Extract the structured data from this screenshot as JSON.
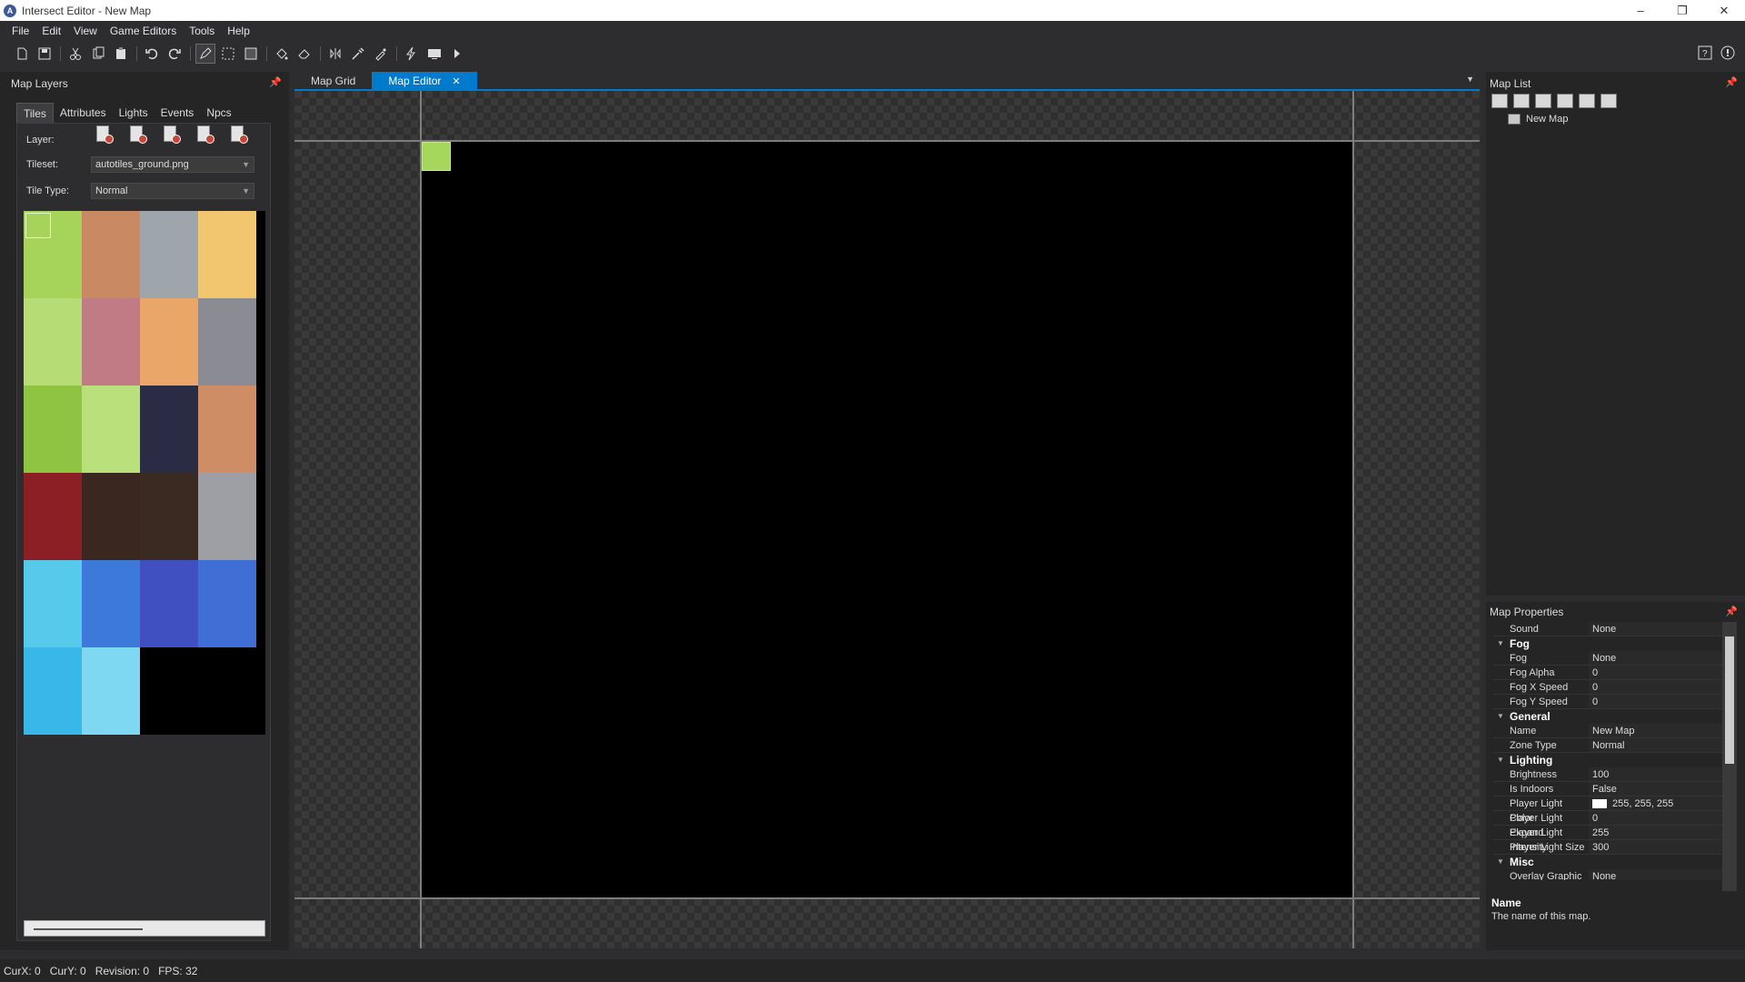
{
  "window": {
    "title": "Intersect Editor - New Map",
    "logo": "A",
    "minimize": "–",
    "restore": "❐",
    "close": "✕"
  },
  "menu": [
    "File",
    "Edit",
    "View",
    "Game Editors",
    "Tools",
    "Help"
  ],
  "toolbar_icons": [
    "new-map-icon",
    "save-icon",
    "cut-icon",
    "copy-icon",
    "paste-icon",
    "undo-icon",
    "redo-icon",
    "pen-tool-icon",
    "selection-tool-icon",
    "rectangle-tool-icon",
    "fill-tool-icon",
    "erase-tool-icon",
    "eyedropper-icon",
    "flip-icon",
    "dropper-icon",
    "lightning-icon",
    "screenshot-icon",
    "play-icon"
  ],
  "map_layers": {
    "title": "Map Layers",
    "tabs": [
      "Tiles",
      "Attributes",
      "Lights",
      "Events",
      "Npcs"
    ],
    "active_tab": "Tiles",
    "layer_label": "Layer:",
    "tileset_label": "Tileset:",
    "tileset_value": "autotiles_ground.png",
    "tiletype_label": "Tile Type:",
    "tiletype_value": "Normal"
  },
  "doc_tabs": {
    "map_grid": "Map Grid",
    "map_editor": "Map Editor",
    "close": "✕",
    "overflow": "▼"
  },
  "map_list": {
    "title": "Map List",
    "items": [
      "New Map"
    ]
  },
  "map_properties": {
    "title": "Map Properties",
    "rows": [
      {
        "k": "Sound",
        "v": "None"
      },
      {
        "cat": "Fog"
      },
      {
        "k": "Fog",
        "v": "None"
      },
      {
        "k": "Fog Alpha",
        "v": "0"
      },
      {
        "k": "Fog X Speed",
        "v": "0"
      },
      {
        "k": "Fog Y Speed",
        "v": "0"
      },
      {
        "cat": "General"
      },
      {
        "k": "Name",
        "v": "New Map"
      },
      {
        "k": "Zone Type",
        "v": "Normal"
      },
      {
        "cat": "Lighting"
      },
      {
        "k": "Brightness",
        "v": "100"
      },
      {
        "k": "Is Indoors",
        "v": "False"
      },
      {
        "k": "Player Light Color",
        "v": "255, 255, 255",
        "swatch": "#ffffff"
      },
      {
        "k": "Player Light Expand",
        "v": "0"
      },
      {
        "k": "Player Light Intensity",
        "v": "255"
      },
      {
        "k": "Player Light Size",
        "v": "300"
      },
      {
        "cat": "Misc"
      },
      {
        "k": "Overlay Graphic",
        "v": "None"
      }
    ],
    "desc_title": "Name",
    "desc_text": "The name of this map."
  },
  "status": {
    "curx": "CurX: 0",
    "cury": "CurY: 0",
    "revision": "Revision: 0",
    "fps": "FPS: 32"
  },
  "colors": {
    "accent": "#007acc",
    "grass": "#a7d65d",
    "background": "#2d2d30"
  }
}
